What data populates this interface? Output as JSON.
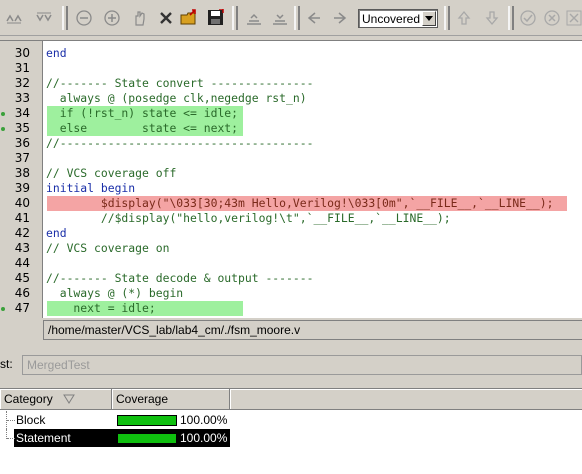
{
  "toolbar": {
    "filter_value": "Uncovered"
  },
  "code": {
    "lines": [
      {
        "n": "30",
        "text": "end",
        "cls": "kw",
        "marker": false,
        "hl": ""
      },
      {
        "n": "31",
        "text": "",
        "cls": "nm",
        "marker": false,
        "hl": ""
      },
      {
        "n": "32",
        "text": "//------- State convert ---------------",
        "cls": "cm",
        "marker": false,
        "hl": ""
      },
      {
        "n": "33",
        "text": "  always @ (posedge clk,negedge rst_n)",
        "cls": "cm",
        "marker": false,
        "hl": ""
      },
      {
        "n": "34",
        "text": "  if (!rst_n) state <= idle;",
        "cls": "cm",
        "marker": true,
        "hl": "green"
      },
      {
        "n": "35",
        "text": "  else        state <= next;",
        "cls": "cm",
        "marker": true,
        "hl": "green"
      },
      {
        "n": "36",
        "text": "//-------------------------------------",
        "cls": "cm",
        "marker": false,
        "hl": ""
      },
      {
        "n": "37",
        "text": "",
        "cls": "nm",
        "marker": false,
        "hl": ""
      },
      {
        "n": "38",
        "text": "// VCS coverage off",
        "cls": "cm",
        "marker": false,
        "hl": ""
      },
      {
        "n": "39",
        "text": "initial begin",
        "cls": "kw",
        "marker": false,
        "hl": ""
      },
      {
        "n": "40",
        "text": "        $display(\"\\033[30;43m Hello,Verilog!\\033[0m\",`__FILE__,`__LINE__);",
        "cls": "pl",
        "marker": false,
        "hl": "red"
      },
      {
        "n": "41",
        "text": "        //$display(\"hello,verilog!\\t\",`__FILE__,`__LINE__);",
        "cls": "cm",
        "marker": false,
        "hl": ""
      },
      {
        "n": "42",
        "text": "end",
        "cls": "kw",
        "marker": false,
        "hl": ""
      },
      {
        "n": "43",
        "text": "// VCS coverage on",
        "cls": "cm",
        "marker": false,
        "hl": ""
      },
      {
        "n": "44",
        "text": "",
        "cls": "nm",
        "marker": false,
        "hl": ""
      },
      {
        "n": "45",
        "text": "//------- State decode & output -------",
        "cls": "cm",
        "marker": false,
        "hl": ""
      },
      {
        "n": "46",
        "text": "  always @ (*) begin",
        "cls": "cm",
        "marker": false,
        "hl": ""
      },
      {
        "n": "47",
        "text": "    next = idle;",
        "cls": "cm",
        "marker": true,
        "hl": "green"
      }
    ]
  },
  "file_path": "/home/master/VCS_lab/lab4_cm/./fsm_moore.v",
  "test": {
    "label": "st:",
    "value": "MergedTest"
  },
  "coverage_table": {
    "headers": {
      "category": "Category",
      "coverage": "Coverage"
    },
    "rows": [
      {
        "name": "Block",
        "percent": "100.00%",
        "fill": 1.0,
        "selected": false
      },
      {
        "name": "Statement",
        "percent": "100.00%",
        "fill": 1.0,
        "selected": true
      }
    ]
  },
  "colors": {
    "covered_highlight": "#9ef09e",
    "uncovered_highlight": "#f4a4a4",
    "bar_fill": "#0fbf0f"
  }
}
